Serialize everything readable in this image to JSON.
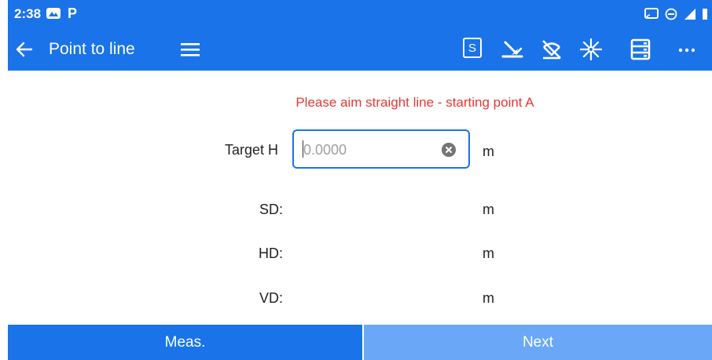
{
  "status_bar": {
    "time": "2:38",
    "indicator": "P"
  },
  "app_bar": {
    "title": "Point to line",
    "s_label": "S"
  },
  "form": {
    "instruction": "Please aim straight line - starting point A",
    "target_h": {
      "label": "Target H",
      "placeholder": "0.0000",
      "value": "",
      "unit": "m"
    },
    "rows": [
      {
        "label": "SD:",
        "unit": "m"
      },
      {
        "label": "HD:",
        "unit": "m"
      },
      {
        "label": "VD:",
        "unit": "m"
      }
    ]
  },
  "buttons": {
    "meas": "Meas.",
    "next": "Next"
  },
  "colors": {
    "primary": "#1a73e8",
    "primary_light": "#6aa7f7",
    "error_text": "#e53935"
  }
}
